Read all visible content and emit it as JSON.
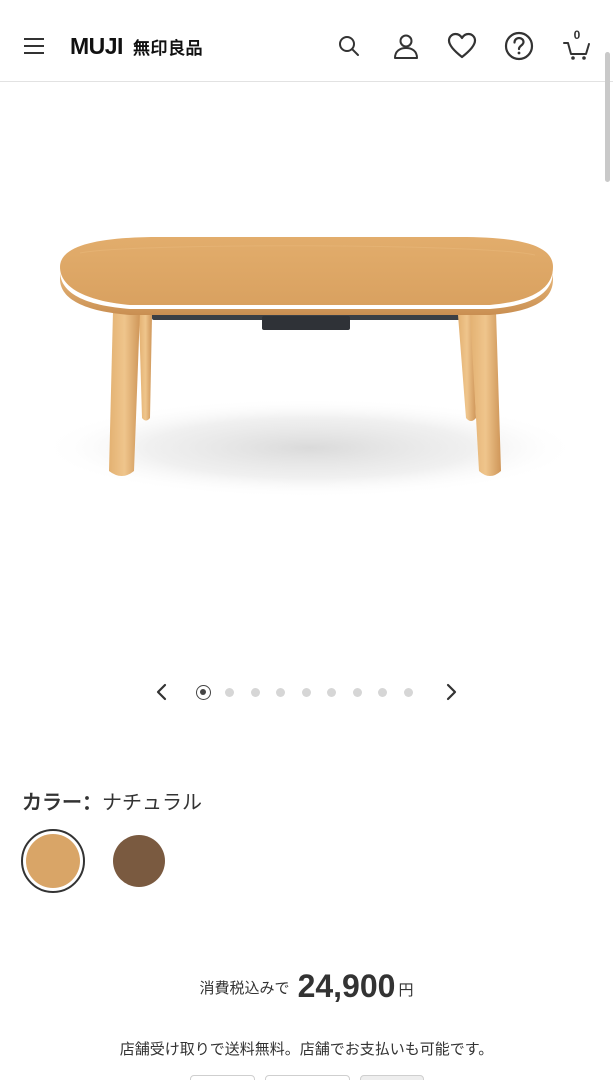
{
  "header": {
    "brand_en": "MUJI",
    "brand_jp": "無印良品",
    "icons": [
      "menu-icon",
      "search-icon",
      "user-icon",
      "heart-icon",
      "help-icon",
      "cart-icon"
    ],
    "cart_count": "0"
  },
  "product": {
    "image_alt": "ナチュラル"
  },
  "carousel": {
    "total": 9,
    "active_index": 1
  },
  "color": {
    "label": "カラー：",
    "value": "ナチュラル",
    "swatches": [
      {
        "name": "ナチュラル",
        "hex": "#d9a567",
        "selected": true
      },
      {
        "name": "ブラウン",
        "hex": "#7a5a40",
        "selected": false
      }
    ]
  },
  "price": {
    "tax_label": "消費税込みで",
    "amount": "24,900",
    "currency": "円"
  },
  "note": "店舗受け取りで送料無料。店舗でお支払いも可能です。",
  "colors": {
    "text": "#333333",
    "wood": "#dea564",
    "divider": "#e2e2e2"
  }
}
